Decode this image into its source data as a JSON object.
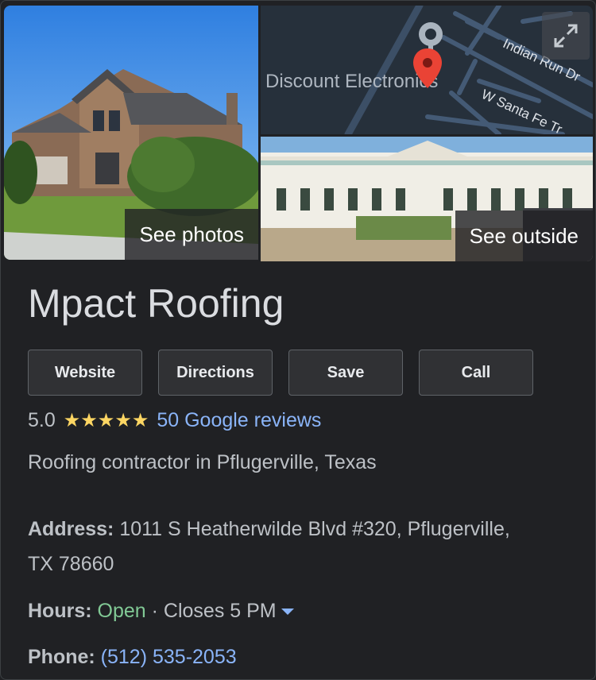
{
  "media": {
    "see_photos": "See photos",
    "see_outside": "See outside",
    "map_poi": "Discount Electronics",
    "streets": [
      "Indian Run Dr",
      "W Santa Fe Tr"
    ]
  },
  "business": {
    "name": "Mpact Roofing",
    "rating": "5.0",
    "stars": "★★★★★",
    "reviews": "50 Google reviews",
    "category": "Roofing contractor in Pflugerville, Texas"
  },
  "actions": {
    "website": "Website",
    "directions": "Directions",
    "save": "Save",
    "call": "Call"
  },
  "info": {
    "address_label": "Address:",
    "address_line1": "1011 S Heatherwilde Blvd #320, Pflugerville,",
    "address_line2": "TX 78660",
    "hours_label": "Hours:",
    "hours_status": "Open",
    "hours_separator": " · ",
    "hours_close": "Closes 5 PM",
    "phone_label": "Phone:",
    "phone": "(512) 535-2053"
  },
  "colors": {
    "background": "#202124",
    "link": "#8ab4f8",
    "open": "#81c995",
    "star": "#fdd663"
  }
}
